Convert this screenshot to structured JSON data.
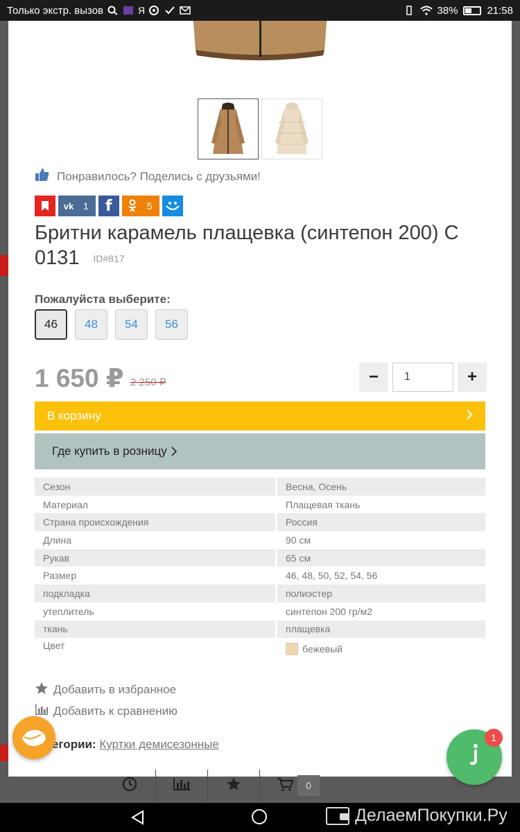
{
  "status": {
    "carrier": "Только экстр. вызов",
    "battery": "38%",
    "time": "21:58"
  },
  "share": {
    "text": "Понравилось? Поделись с друзьями!"
  },
  "social": {
    "vk_count": "1",
    "ok_count": "5",
    "vk_label": "vk",
    "fb_label": "f"
  },
  "product": {
    "title": "Бритни карамель плащевка (синтепон 200) С 0131",
    "id": "ID#817",
    "choose_label": "Пожалуйста выберите:",
    "sizes": [
      "46",
      "48",
      "54",
      "56"
    ],
    "selected_size": "46",
    "price": "1 650 ₽",
    "old_price": "2 250 ₽",
    "quantity": "1"
  },
  "buttons": {
    "cart": "В корзину",
    "retail": "Где купить в розницу",
    "minus": "−",
    "plus": "+"
  },
  "specs": [
    {
      "key": "Сезон",
      "value": "Весна, Осень"
    },
    {
      "key": "Материал",
      "value": "Плащевая ткань"
    },
    {
      "key": "Страна происхождения",
      "value": "Россия"
    },
    {
      "key": "Длина",
      "value": "90 см"
    },
    {
      "key": "Рукав",
      "value": "65 см"
    },
    {
      "key": "Размер",
      "value": "46, 48, 50, 52, 54, 56"
    },
    {
      "key": "подкладка",
      "value": "полиэстер"
    },
    {
      "key": "утеплитель",
      "value": "синтепон 200 гр/м2"
    },
    {
      "key": "ткань",
      "value": "плащевка"
    },
    {
      "key": "Цвет",
      "value": "бежевый"
    }
  ],
  "colors": {
    "accent_yellow": "#fcc20b",
    "retail_bg": "#b1c3c1",
    "swatch": "#f2d6ae"
  },
  "actions": {
    "favorite": "Добавить в избранное",
    "compare": "Добавить к сравнению"
  },
  "categories": {
    "label": "егории:",
    "link": "Куртки демисезонные"
  },
  "chat": {
    "badge": "1"
  },
  "toolbar": {
    "cart_count": "0"
  },
  "watermark": "ДелаемПокупки.Ру"
}
